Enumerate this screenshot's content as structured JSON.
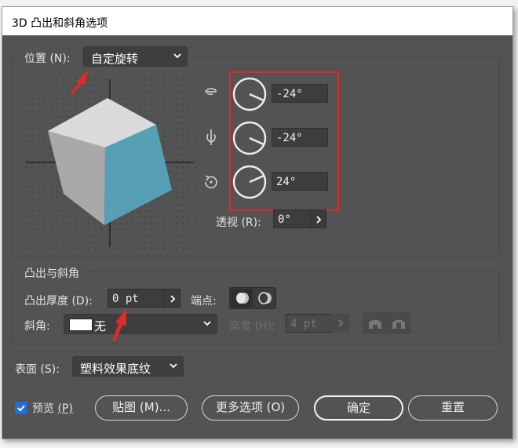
{
  "window": {
    "title": "3D 凸出和斜角选项"
  },
  "position": {
    "label": "位置 (N):",
    "preset": "自定旋转",
    "x_rotation": "-24°",
    "y_rotation": "-24°",
    "z_rotation": "24°",
    "perspective_label": "透视 (R):",
    "perspective_value": "0°"
  },
  "extrude": {
    "group_label": "凸出与斜角",
    "depth_label": "凸出厚度 (D):",
    "depth_value": "0 pt",
    "cap_label": "端点:",
    "bevel_label": "斜角:",
    "bevel_value": "无",
    "height_label": "高度 (H):",
    "height_value": "4 pt"
  },
  "surface": {
    "label": "表面 (S):",
    "value": "塑料效果底纹"
  },
  "footer": {
    "preview_label": "预览",
    "preview_key": "(P)",
    "preview_checked": true,
    "map_button": "贴图 (M)...",
    "more_button": "更多选项 (O)",
    "ok_button": "确定",
    "reset_button": "重置"
  },
  "colors": {
    "dialog_bg": "#535353",
    "cube_front": "#569fb5",
    "cube_top": "#dadada",
    "cube_left": "#a9a9a9",
    "annotation": "#e02a2a",
    "checkbox": "#1f6fd6"
  }
}
